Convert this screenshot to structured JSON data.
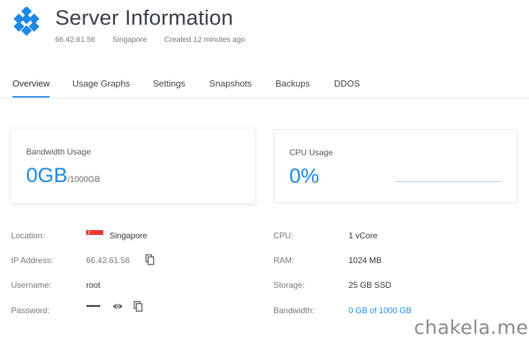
{
  "header": {
    "title": "Server Information",
    "ip": "66.42.61.56",
    "region": "Singapore",
    "created": "Created 12 minutes ago"
  },
  "tabs": [
    {
      "label": "Overview",
      "active": true
    },
    {
      "label": "Usage Graphs"
    },
    {
      "label": "Settings"
    },
    {
      "label": "Snapshots"
    },
    {
      "label": "Backups"
    },
    {
      "label": "DDOS"
    }
  ],
  "bandwidth_card": {
    "label": "Bandwidth Usage",
    "value": "0GB",
    "unit": "/1000GB"
  },
  "cpu_card": {
    "label": "CPU Usage",
    "value": "0%"
  },
  "details_left": {
    "location_label": "Location:",
    "location_value": "Singapore",
    "ip_label": "IP Address:",
    "ip_value": "66.42.61.56",
    "username_label": "Username:",
    "username_value": "root",
    "password_label": "Password:",
    "password_value": "•••••••"
  },
  "details_right": {
    "cpu_label": "CPU:",
    "cpu_value": "1 vCore",
    "ram_label": "RAM:",
    "ram_value": "1024 MB",
    "storage_label": "Storage:",
    "storage_value": "25 GB SSD",
    "bandwidth_label": "Bandwidth:",
    "bandwidth_value": "0 GB of 1000 GB"
  },
  "colors": {
    "accent": "#1e88e5",
    "logo": "#1e88e5"
  },
  "icons": {
    "logo": "cube-logo-icon",
    "flag": "singapore-flag-icon",
    "copy": "copy-icon",
    "show_password": "eye-icon"
  },
  "watermark": "chakela.me"
}
